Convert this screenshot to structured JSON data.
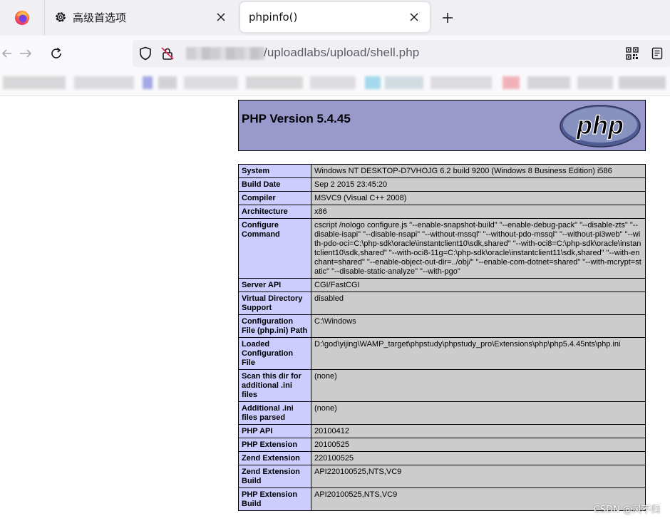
{
  "browser": {
    "tabs": [
      {
        "title": "高级首选项",
        "icon": "gear-icon"
      },
      {
        "title": "phpinfo()",
        "active": true
      }
    ],
    "url": "/uploadlabs/upload/shell.php",
    "accent": "#ff7139"
  },
  "page": {
    "version_title": "PHP Version 5.4.45",
    "logo_text": "php",
    "rows": [
      {
        "key": "System",
        "value": "Windows NT DESKTOP-D7VHOJG 6.2 build 9200 (Windows 8 Business Edition) i586"
      },
      {
        "key": "Build Date",
        "value": "Sep 2 2015 23:45:20"
      },
      {
        "key": "Compiler",
        "value": "MSVC9 (Visual C++ 2008)"
      },
      {
        "key": "Architecture",
        "value": "x86"
      },
      {
        "key": "Configure Command",
        "value": "cscript /nologo configure.js \"--enable-snapshot-build\" \"--enable-debug-pack\" \"--disable-zts\" \"--disable-isapi\" \"--disable-nsapi\" \"--without-mssql\" \"--without-pdo-mssql\" \"--without-pi3web\" \"--with-pdo-oci=C:\\php-sdk\\oracle\\instantclient10\\sdk,shared\" \"--with-oci8=C:\\php-sdk\\oracle\\instantclient10\\sdk,shared\" \"--with-oci8-11g=C:\\php-sdk\\oracle\\instantclient11\\sdk,shared\" \"--with-enchant=shared\" \"--enable-object-out-dir=../obj/\" \"--enable-com-dotnet=shared\" \"--with-mcrypt=static\" \"--disable-static-analyze\" \"--with-pgo\""
      },
      {
        "key": "Server API",
        "value": "CGI/FastCGI"
      },
      {
        "key": "Virtual Directory Support",
        "value": "disabled"
      },
      {
        "key": "Configuration File (php.ini) Path",
        "value": "C:\\Windows"
      },
      {
        "key": "Loaded Configuration File",
        "value": "D:\\god\\yijing\\WAMP_target\\phpstudy\\phpstudy_pro\\Extensions\\php\\php5.4.45nts\\php.ini"
      },
      {
        "key": "Scan this dir for additional .ini files",
        "value": "(none)"
      },
      {
        "key": "Additional .ini files parsed",
        "value": "(none)"
      },
      {
        "key": "PHP API",
        "value": "20100412"
      },
      {
        "key": "PHP Extension",
        "value": "20100525"
      },
      {
        "key": "Zend Extension",
        "value": "220100525"
      },
      {
        "key": "Zend Extension Build",
        "value": "API220100525,NTS,VC9"
      },
      {
        "key": "PHP Extension Build",
        "value": "API20100525,NTS,VC9"
      }
    ]
  },
  "watermark": "CSDN @风不归"
}
